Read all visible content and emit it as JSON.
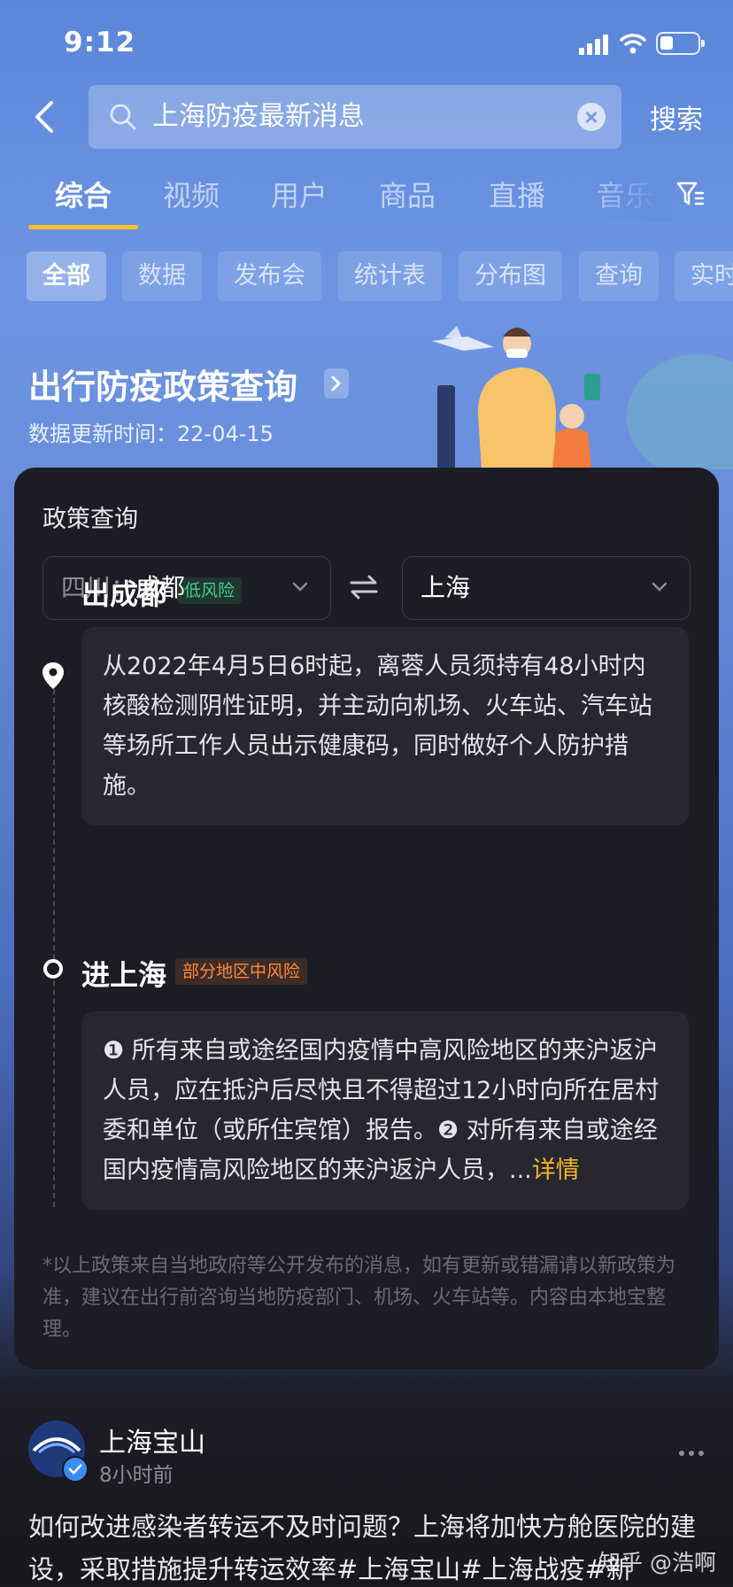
{
  "status_bar": {
    "time": "9:12"
  },
  "search": {
    "query": "上海防疫最新消息",
    "submit_label": "搜索"
  },
  "tabs": [
    {
      "label": "综合",
      "active": true
    },
    {
      "label": "视频",
      "active": false
    },
    {
      "label": "用户",
      "active": false
    },
    {
      "label": "商品",
      "active": false
    },
    {
      "label": "直播",
      "active": false
    },
    {
      "label": "音乐",
      "active": false
    }
  ],
  "chips": [
    {
      "label": "全部",
      "active": true
    },
    {
      "label": "数据",
      "active": false
    },
    {
      "label": "发布会",
      "active": false
    },
    {
      "label": "统计表",
      "active": false
    },
    {
      "label": "分布图",
      "active": false
    },
    {
      "label": "查询",
      "active": false
    },
    {
      "label": "实时",
      "active": false
    }
  ],
  "banner": {
    "title": "出行防疫政策查询",
    "update_time": "数据更新时间：22-04-15"
  },
  "policy": {
    "heading": "政策查询",
    "from": {
      "province": "四川：",
      "city": "成都"
    },
    "to": {
      "city": "上海"
    },
    "departure": {
      "title": "出成都",
      "risk": "低风险",
      "text": "从2022年4月5日6时起，离蓉人员须持有48小时内核酸检测阴性证明，并主动向机场、火车站、汽车站等场所工作人员出示健康码，同时做好个人防护措施。"
    },
    "arrival": {
      "title": "进上海",
      "risk": "部分地区中风险",
      "text": "❶ 所有来自或途经国内疫情中高风险地区的来沪返沪人员，应在抵沪后尽快且不得超过12小时向所在居村委和单位（或所住宾馆）报告。❷ 对所有来自或途经国内疫情高风险地区的来沪返沪人员，...",
      "more": "详情"
    },
    "disclaimer": "*以上政策来自当地政府等公开发布的消息，如有更新或错漏请以新政策为准，建议在出行前咨询当地防疫部门、机场、火车站等。内容由本地宝整理。"
  },
  "post": {
    "author": "上海宝山",
    "time": "8小时前",
    "body": "如何改进感染者转运不及时问题？上海将加快方舱医院的建设，采取措施提升转运效率#上海宝山#上海战疫#新"
  },
  "watermark": "知乎 @浩啊",
  "colors": {
    "accent_yellow": "#f5c026",
    "risk_low": "#3fd08a",
    "risk_mid": "#ff8a3d",
    "card_bg": "#1c1c24"
  }
}
